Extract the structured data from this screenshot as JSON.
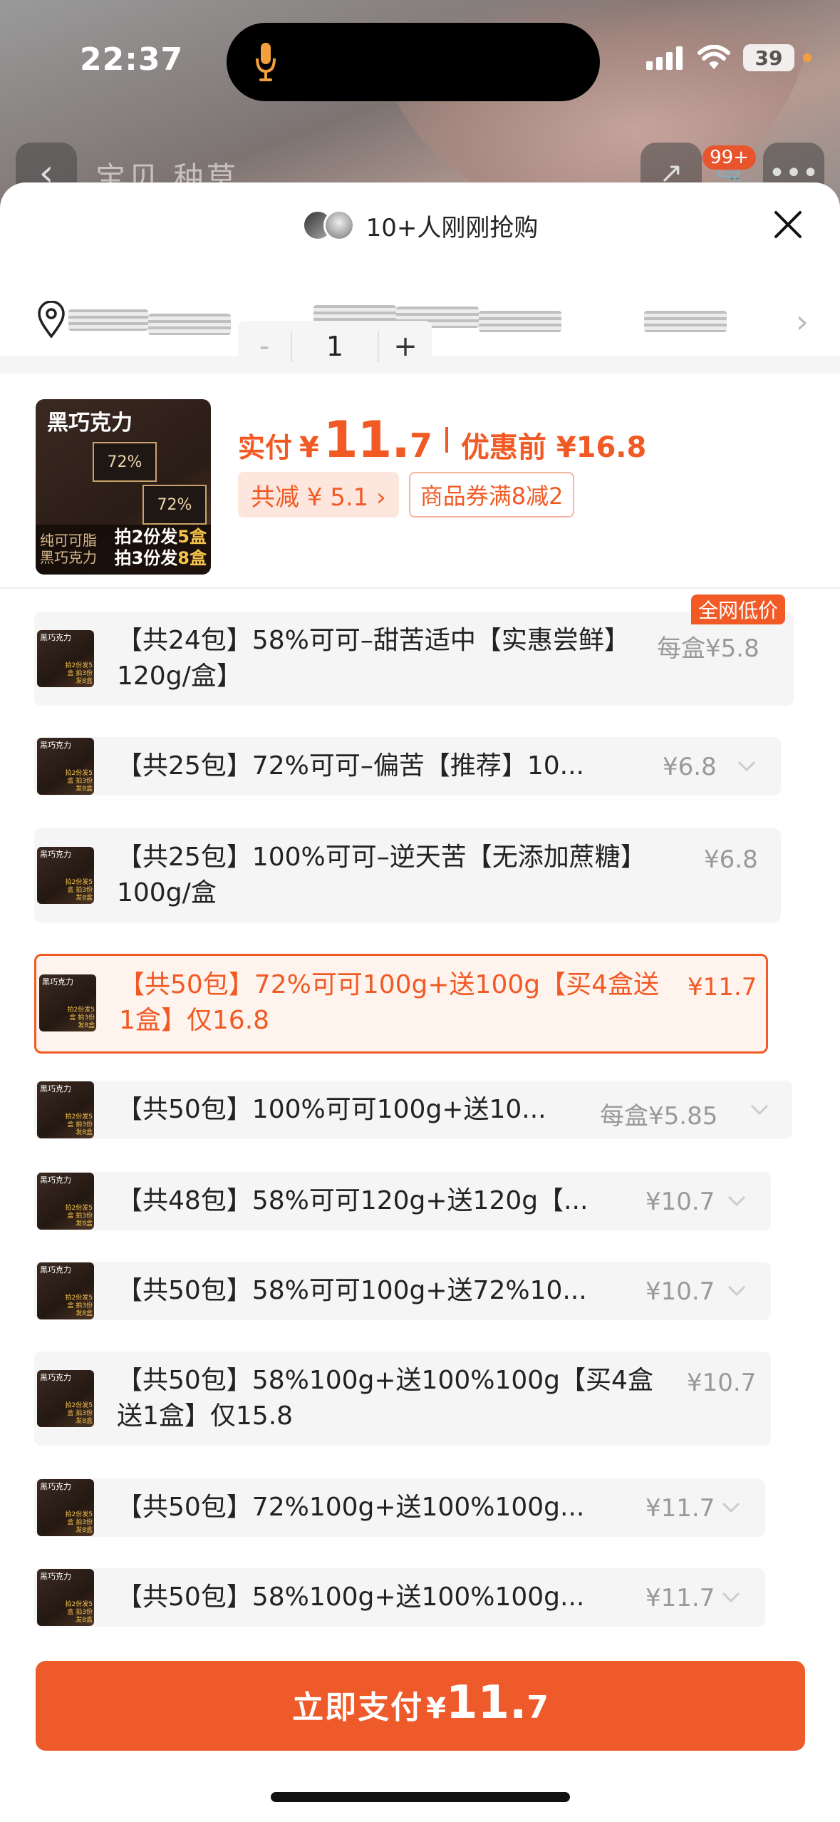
{
  "status_bar": {
    "time": "22:37",
    "battery": "39"
  },
  "background_page": {
    "tabs_text": "宝贝 种草",
    "cart_badge": "99+"
  },
  "sheet": {
    "header_text": "10+人刚刚抢购",
    "product": {
      "thumb_title": "黑巧克力",
      "thumb_tag": "72%",
      "thumb_tag2": "72%",
      "thumb_left": "纯可可脂 黑巧克力",
      "thumb_promo_1a": "拍2份发",
      "thumb_promo_1b": "5盒",
      "thumb_promo_2a": "拍3份发",
      "thumb_promo_2b": "8盒",
      "price_label": "实付",
      "price_yen": "¥",
      "price_int": "11.",
      "price_dec": "7",
      "price_before": "优惠前 ¥16.8",
      "discount_pill": "共减 ¥ 5.1 ›",
      "coupon": "商品券满8减2",
      "quantity": "1",
      "minus": "-",
      "plus": "+"
    },
    "low_price_badge": "全网低价",
    "skus": [
      {
        "name": "【共24包】58%可可–甜苦适中【实惠尝鲜】120g/盒】",
        "price": "每盒¥5.8"
      },
      {
        "name": "【共25包】72%可可–偏苦【推荐】10...",
        "price": "¥6.8"
      },
      {
        "name": "【共25包】100%可可–逆天苦【无添加蔗糖】100g/盒",
        "price": "¥6.8"
      },
      {
        "name": "【共50包】72%可可100g+送100g【买4盒送1盒】仅16.8",
        "price": "¥11.7"
      },
      {
        "name": "【共50包】100%可可100g+送10...",
        "price": "每盒¥5.85"
      },
      {
        "name": "【共48包】58%可可120g+送120g【...",
        "price": "¥10.7"
      },
      {
        "name": "【共50包】58%可可100g+送72%10...",
        "price": "¥10.7"
      },
      {
        "name": "【共50包】58%100g+送100%100g【买4盒送1盒】仅15.8",
        "price": "¥10.7"
      },
      {
        "name": "【共50包】72%100g+送100%100g...",
        "price": "¥11.7"
      },
      {
        "name": "【共50包】58%100g+送100%100g...",
        "price": "¥11.7"
      }
    ],
    "pay_button": {
      "label": "立即支付",
      "yen": "¥",
      "int": "11.",
      "dec": "7"
    }
  },
  "colors": {
    "accent": "#f15a24",
    "pay_button": "#ee5a2a"
  }
}
